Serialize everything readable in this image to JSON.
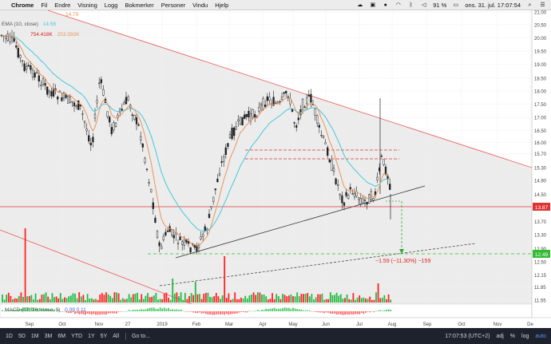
{
  "menubar": {
    "app": "Chrome",
    "menus": [
      "Fil",
      "Endre",
      "Visning",
      "Logg",
      "Bokmerker",
      "Personer",
      "Vindu",
      "Hjelp"
    ],
    "battery": "91 %",
    "datetime": "ons. 31. jul.  17:07:54"
  },
  "indicators": {
    "line1_value": "14.79",
    "line2_label": "EMA (10, close)",
    "line2_value": "14.58",
    "line3_value1": "754.418K",
    "line3_value2": "253.592K",
    "macd_label": "MACD (12, 26, close, 9)",
    "macd_values": "0.09   0.11"
  },
  "chart_data": {
    "type": "candlestick",
    "price_axis_ticks": [
      "21.00",
      "20.50",
      "20.00",
      "19.50",
      "19.00",
      "18.50",
      "18.00",
      "17.50",
      "17.00",
      "16.50",
      "16.00",
      "15.70",
      "15.30",
      "14.90",
      "14.50",
      "14.10",
      "13.70",
      "13.30",
      "12.90",
      "12.50",
      "12.15",
      "11.85",
      "11.55",
      "11.27"
    ],
    "time_axis_labels": [
      "Sep",
      "Oct",
      "Nov",
      "27",
      "2019",
      "Feb",
      "Mar",
      "Apr",
      "May",
      "Jun",
      "Jul",
      "Aug",
      "Sep",
      "Oct",
      "Nov",
      "De"
    ],
    "last_price": "13.87",
    "target_price": "12.49",
    "measure_label": "−1.59 (−11.30%) −159",
    "colors": {
      "up": "#ff2222",
      "down": "#22bb44",
      "ema_fast": "#e8955a",
      "ema_slow": "#46c7d9",
      "resistance": "#ee5555",
      "support": "#222222",
      "target": "#22aa22"
    }
  },
  "bottombar": {
    "timeframes": [
      "1D",
      "5D",
      "1M",
      "3M",
      "6M",
      "YTD",
      "1Y",
      "5Y",
      "All"
    ],
    "goto": "Go to...",
    "clock": "17:07:53 (UTC+2)",
    "adj": "adj",
    "percent": "%",
    "log": "log",
    "auto": "auto"
  }
}
